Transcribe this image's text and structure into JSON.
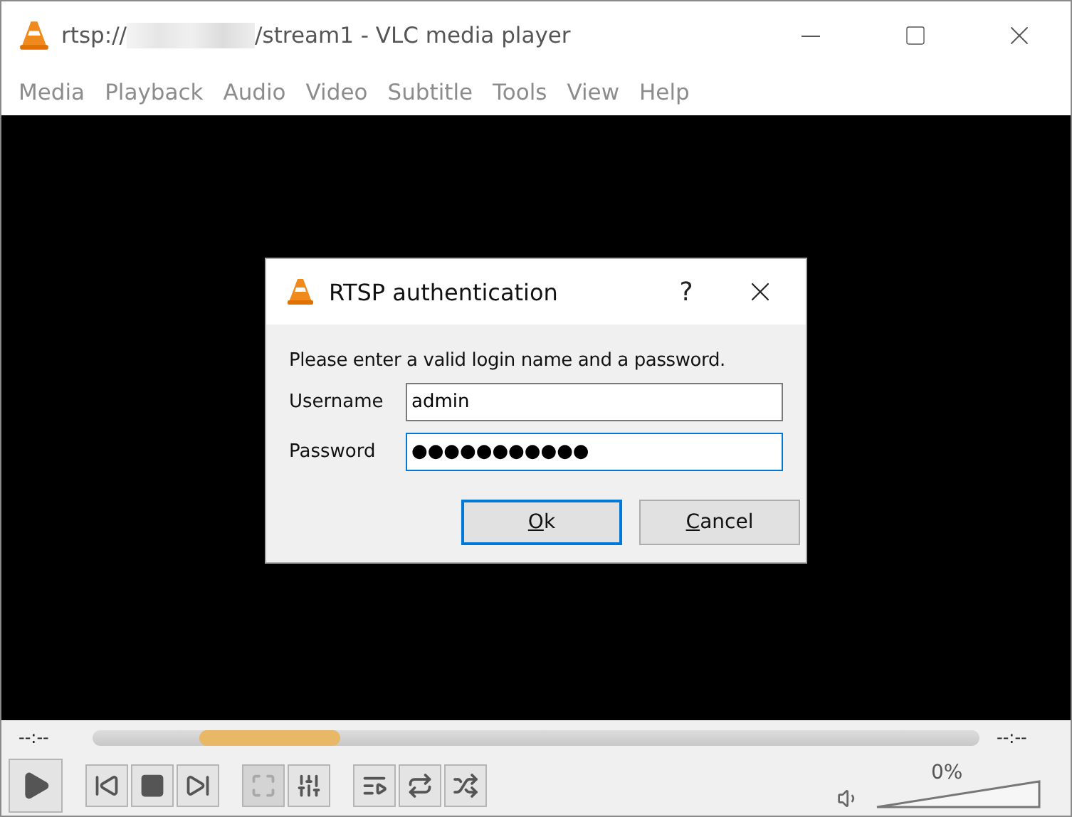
{
  "window": {
    "title_prefix": "rtsp://",
    "title_suffix": "/stream1 - VLC media player",
    "redacted": true
  },
  "menu": [
    "Media",
    "Playback",
    "Audio",
    "Video",
    "Subtitle",
    "Tools",
    "View",
    "Help"
  ],
  "dialog": {
    "title": "RTSP authentication",
    "help": "?",
    "message": "Please enter a valid login name and a password.",
    "fields": [
      {
        "label": "Username",
        "value": "admin",
        "focused": false
      },
      {
        "label": "Password",
        "value": "●●●●●●●●●●●",
        "focused": true
      }
    ],
    "buttons": [
      {
        "mnemonic": "O",
        "rest": "k",
        "default": true
      },
      {
        "mnemonic": "C",
        "rest": "ancel",
        "default": false
      }
    ]
  },
  "seek": {
    "elapsed": "--:--",
    "remaining": "--:--",
    "buffering": true
  },
  "controls": [
    {
      "kind": "play",
      "disabled": false
    },
    {
      "kind": "prev",
      "disabled": false
    },
    {
      "kind": "stop",
      "disabled": false
    },
    {
      "kind": "next",
      "disabled": false
    },
    {
      "kind": "fullscreen",
      "disabled": true
    },
    {
      "kind": "extended",
      "disabled": false
    },
    {
      "kind": "playlist",
      "disabled": false
    },
    {
      "kind": "loop",
      "disabled": false
    },
    {
      "kind": "random",
      "disabled": false
    }
  ],
  "volume": {
    "reading": "0%"
  }
}
